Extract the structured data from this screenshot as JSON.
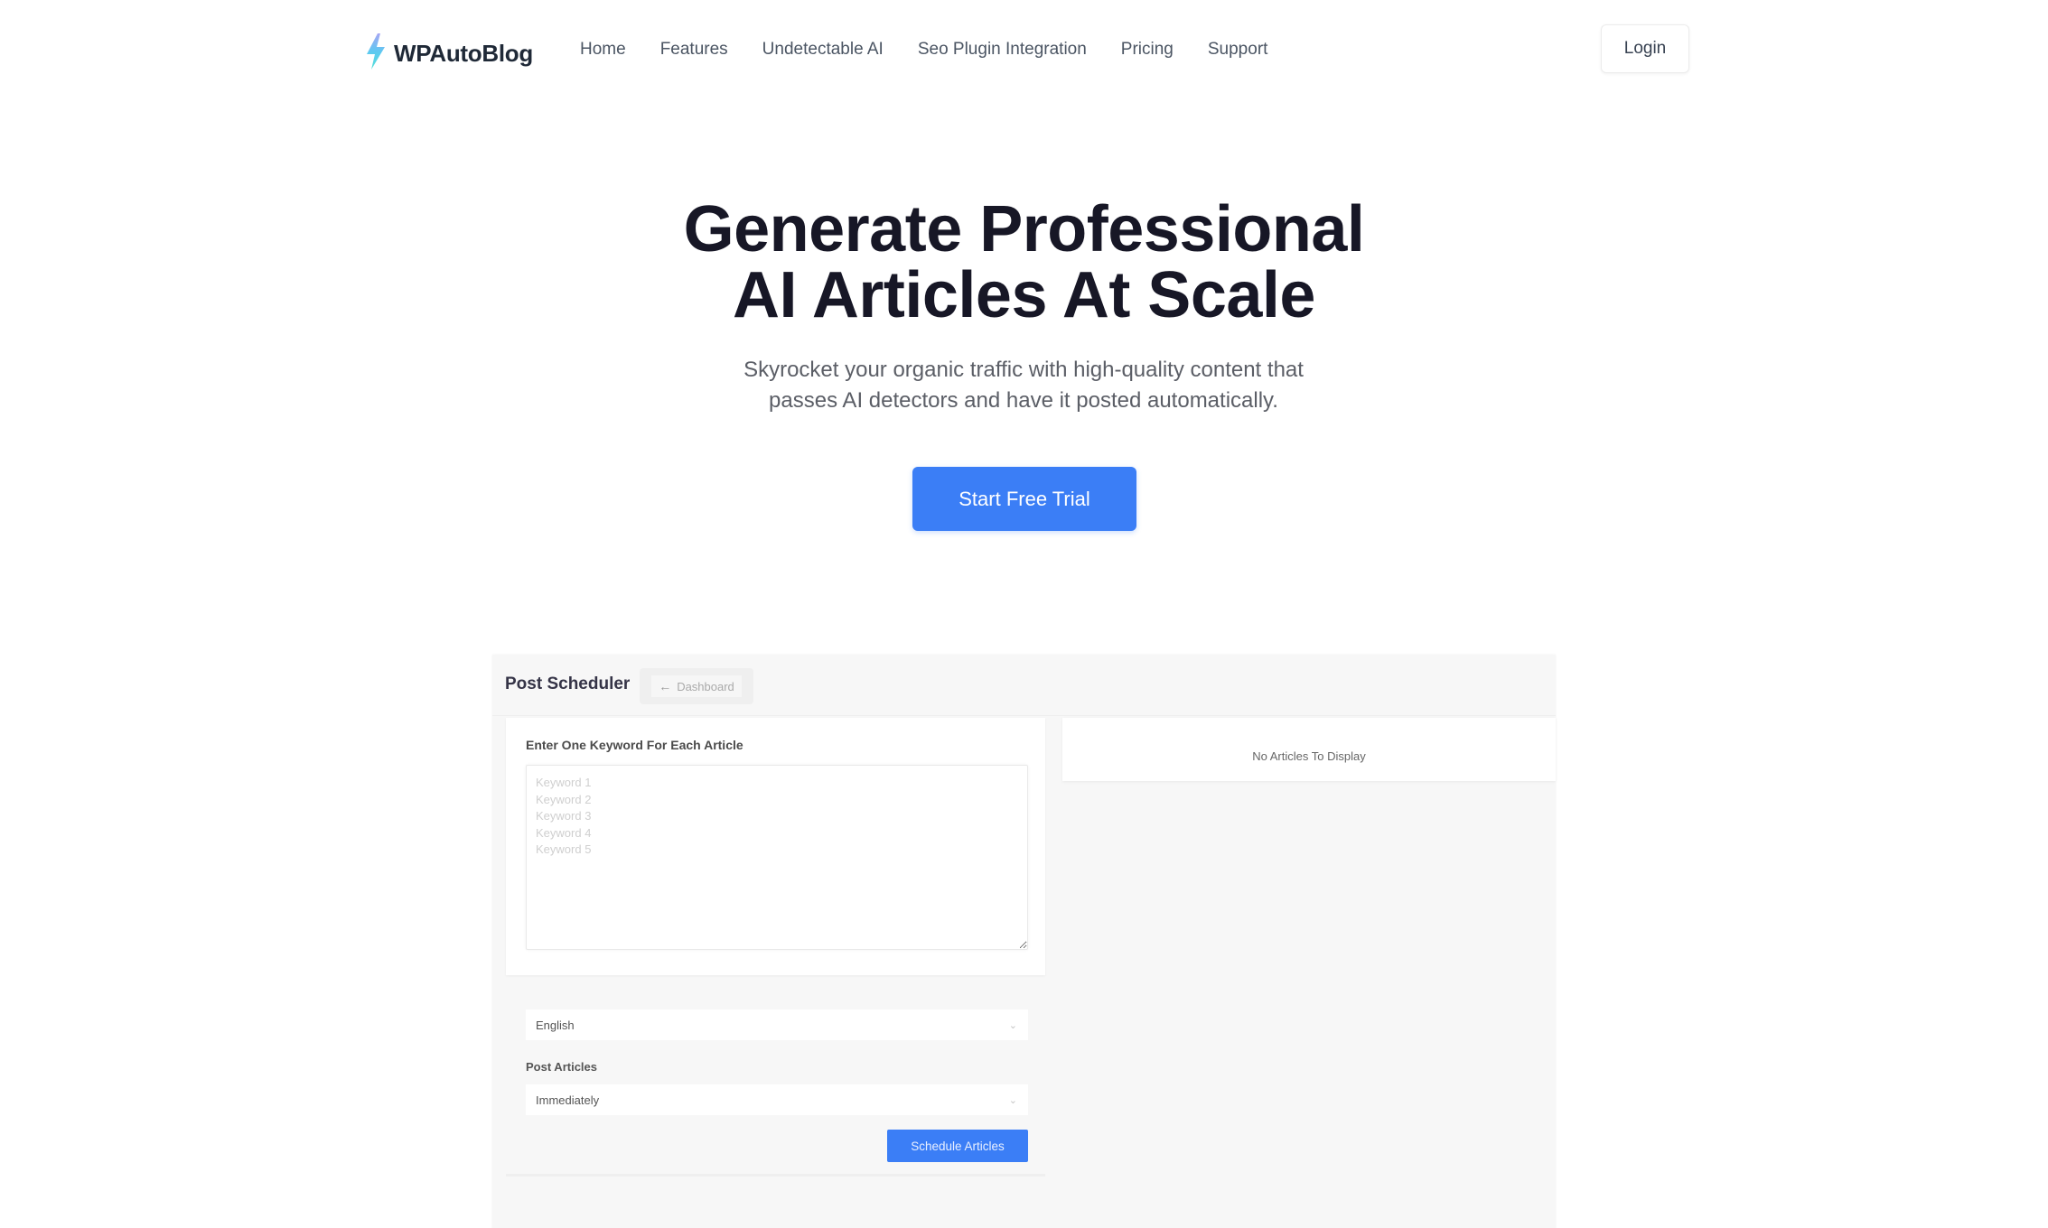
{
  "nav": {
    "brand": "WPAutoBlog",
    "brand_icon": "lightning-bolt-icon",
    "links": [
      "Home",
      "Features",
      "Undetectable AI",
      "Seo Plugin Integration",
      "Pricing",
      "Support"
    ],
    "login_label": "Login"
  },
  "hero": {
    "title_line1": "Generate Professional",
    "title_line2": "AI Articles At Scale",
    "subtitle_line1": "Skyrocket your organic traffic with high-quality content that",
    "subtitle_line2": "passes AI detectors and have it posted automatically.",
    "cta_label": "Start Free Trial"
  },
  "app_preview": {
    "title": "Post Scheduler",
    "back_button": {
      "icon": "arrow-left-icon",
      "label": "Dashboard"
    },
    "keywords": {
      "label": "Enter One Keyword For Each Article",
      "placeholder": "Keyword 1\nKeyword 2\nKeyword 3\nKeyword 4\nKeyword 5",
      "value": ""
    },
    "language_select": {
      "value": "English"
    },
    "post_articles": {
      "label": "Post Articles",
      "value": "Immediately"
    },
    "schedule_button": "Schedule Articles",
    "empty_state": "No Articles To Display"
  },
  "colors": {
    "accent": "#3b7ef6",
    "heading": "#171726",
    "logo_bolt": "#5ec8f2"
  }
}
